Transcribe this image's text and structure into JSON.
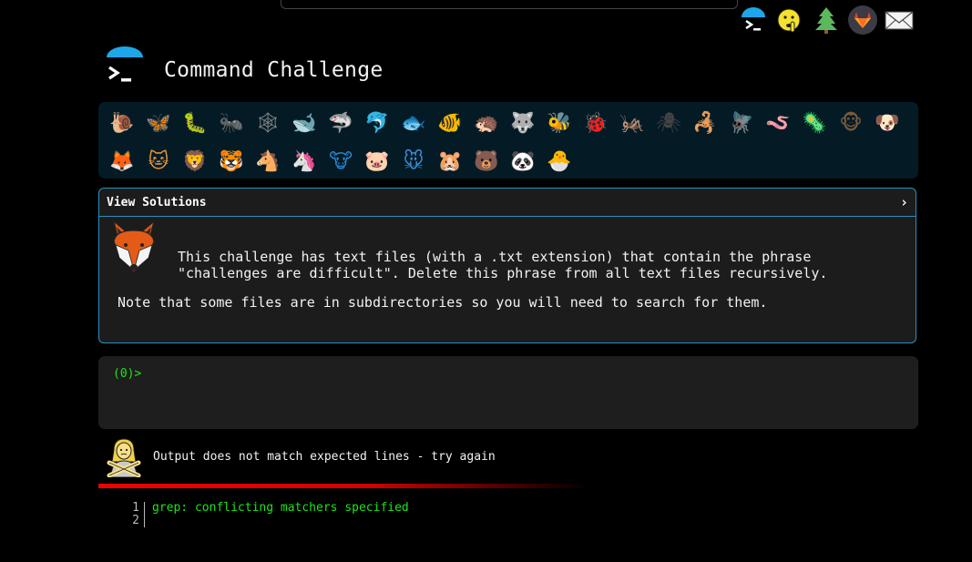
{
  "app": {
    "title": "Command Challenge"
  },
  "top_nav": {
    "icons": [
      "terminal-umbrella-icon",
      "shushing-face-icon",
      "tree-icon",
      "gitlab-icon",
      "envelope-icon"
    ]
  },
  "animals": {
    "row1": [
      "snail",
      "butterfly",
      "caterpillar",
      "ant",
      "spider-web",
      "whale",
      "shark",
      "dolphin",
      "fish",
      "tropical-fish",
      "hedgehog",
      "wolf",
      "bee",
      "ladybug",
      "cricket",
      "spider",
      "scorpion",
      "fly",
      "worm",
      "microbe",
      "monkey",
      "dog"
    ],
    "row2": [
      "fox",
      "cat",
      "lion",
      "tiger",
      "horse",
      "unicorn",
      "cow",
      "pig",
      "mouse",
      "hamster",
      "bear",
      "panda",
      "chick"
    ]
  },
  "solutions": {
    "title": "View Solutions",
    "chevron": "›",
    "description": "This challenge has text files (with a .txt extension) that contain the phrase\n\"challenges are difficult\". Delete this phrase from all text files recursively.",
    "note": "Note that some files are in subdirectories so you will need to search for them."
  },
  "terminal": {
    "prompt": "(0)>"
  },
  "result": {
    "message": "Output does not match expected lines - try again"
  },
  "output": {
    "lines": [
      {
        "number": "1",
        "text": "grep: conflicting matchers specified"
      },
      {
        "number": "2",
        "text": ""
      }
    ]
  },
  "colors": {
    "background": "#000000",
    "panel": "#041b26",
    "card_border": "#2a8fbf",
    "prompt_green": "#19e619",
    "error_red": "#ee0000"
  }
}
